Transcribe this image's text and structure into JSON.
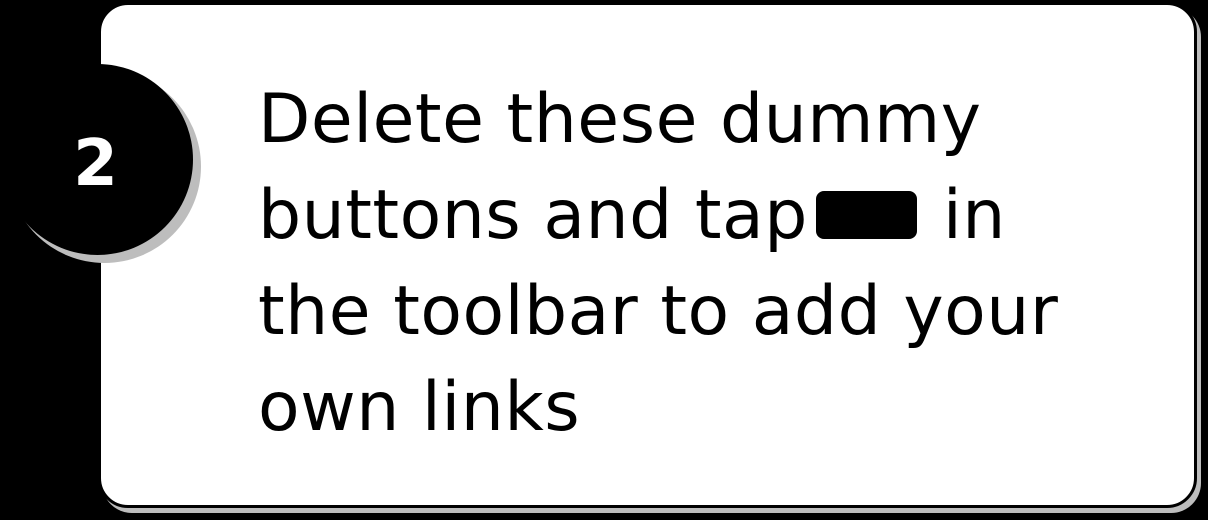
{
  "step": {
    "number": "2"
  },
  "instruction": {
    "line_1": "Delete these dummy",
    "line_2_before_icon": "buttons and tap",
    "line_2_after_icon": "in",
    "line_3": "the toolbar to add your",
    "line_4": "own links",
    "inline_icon": "toolbar-button-icon"
  },
  "colors": {
    "background": "#000000",
    "card": "#ffffff",
    "text": "#000000",
    "badge": "#000000",
    "badge_text": "#ffffff",
    "shadow": "#bdbdbd"
  }
}
